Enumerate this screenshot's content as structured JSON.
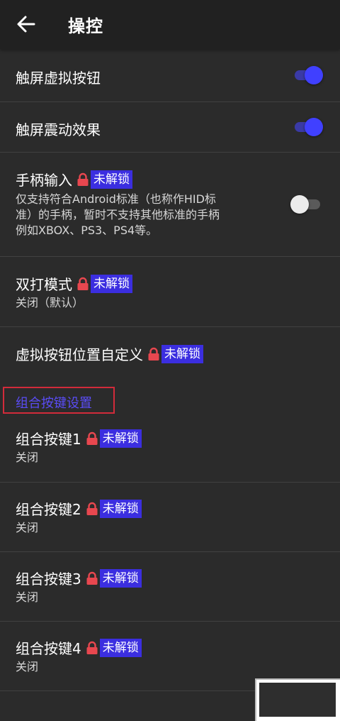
{
  "appbar": {
    "title": "操控",
    "back_icon": "arrow-left-icon"
  },
  "colors": {
    "background": "#2b2b2b",
    "appbar": "#212121",
    "accent": "#4040ff",
    "badge": "#3b2ee0",
    "lock": "#e8474f",
    "section_text": "#5a4cf5",
    "highlight_border": "#d22b3a"
  },
  "badge_text": "未解锁",
  "settings": {
    "touch_buttons": {
      "label": "触屏虚拟按钮",
      "enabled": true
    },
    "touch_vibration": {
      "label": "触屏震动效果",
      "enabled": true
    },
    "gamepad": {
      "label": "手柄输入",
      "description_lines": [
        "仅支持符合Android标准（也称作HID标",
        "准）的手柄，暂时不支持其他标准的手柄",
        "例如XBOX、PS3、PS4等。"
      ],
      "enabled": false,
      "locked": true
    },
    "double_hit": {
      "label": "双打模式",
      "value": "关闭（默认）",
      "locked": true
    },
    "custom_position": {
      "label": "虚拟按钮位置自定义",
      "locked": true
    }
  },
  "combo_section": {
    "title": "组合按键设置",
    "items": [
      {
        "label": "组合按键1",
        "value": "关闭",
        "locked": true
      },
      {
        "label": "组合按键2",
        "value": "关闭",
        "locked": true
      },
      {
        "label": "组合按键3",
        "value": "关闭",
        "locked": true
      },
      {
        "label": "组合按键4",
        "value": "关闭",
        "locked": true
      }
    ]
  }
}
